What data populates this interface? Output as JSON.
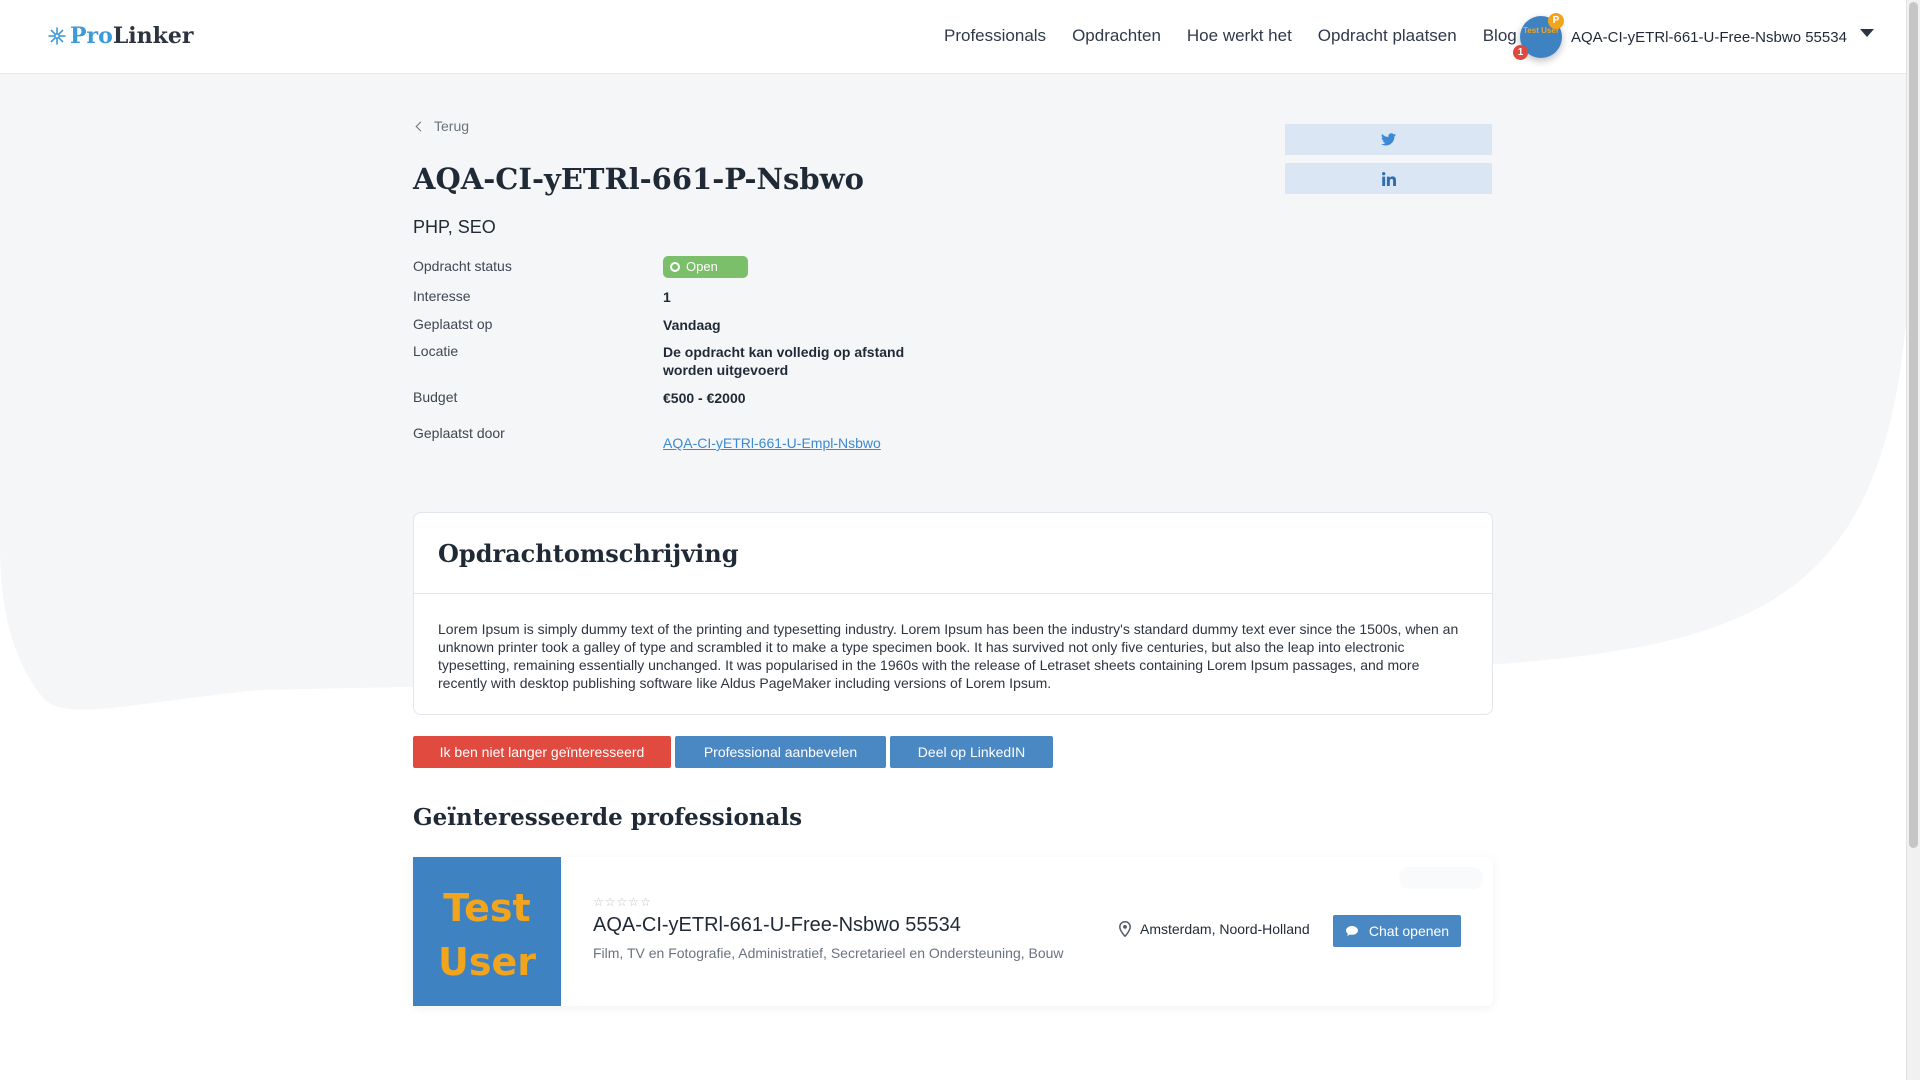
{
  "header": {
    "logo_pro": "Pro",
    "logo_linker": "Linker",
    "nav": [
      "Professionals",
      "Opdrachten",
      "Hoe werkt het",
      "Opdracht plaatsen",
      "Blog"
    ],
    "avatar_text": "Test User",
    "avatar_badge": "P",
    "notification_count": "1",
    "user_name": "AQA-CI-yETRl-661-U-Free-Nsbwo 55534"
  },
  "page": {
    "back_label": "Terug",
    "title": "AQA-CI-yETRl-661-P-Nsbwo",
    "skills": "PHP, SEO",
    "share_icons": [
      "twitter-icon",
      "linkedin-icon"
    ]
  },
  "details": {
    "status_label": "Opdracht status",
    "status_value": "Open",
    "interest_label": "Interesse",
    "interest_value": "1",
    "posted_label": "Geplaatst op",
    "posted_value": "Vandaag",
    "location_label": "Locatie",
    "location_value": "De opdracht kan volledig op afstand worden uitgevoerd",
    "budget_label": "Budget",
    "budget_value": "€500 - €2000",
    "posted_by_label": "Geplaatst door",
    "posted_by_value": "AQA-CI-yETRl-661-U-Empl-Nsbwo"
  },
  "description": {
    "heading": "Opdrachtomschrijving",
    "text": "Lorem Ipsum is simply dummy text of the printing and typesetting industry. Lorem Ipsum has been the industry's standard dummy text ever since the 1500s, when an unknown printer took a galley of type and scrambled it to make a type specimen book. It has survived not only five centuries, but also the leap into electronic typesetting, remaining essentially unchanged. It was popularised in the 1960s with the release of Letraset sheets containing Lorem Ipsum passages, and more recently with desktop publishing software like Aldus PageMaker including versions of Lorem Ipsum."
  },
  "actions": {
    "not_interested": "Ik ben niet langer geïnteresseerd",
    "recommend": "Professional aanbevelen",
    "share_linkedin": "Deel op LinkedIN"
  },
  "interested": {
    "heading": "Geïnteresseerde professionals",
    "items": [
      {
        "image_text_1": "Test",
        "image_text_2": "User",
        "rating": 0,
        "rating_max": 5,
        "name": "AQA-CI-yETRl-661-U-Free-Nsbwo 55534",
        "categories": "Film, TV en Fotografie, Administratief, Secretarieel en Ondersteuning, Bouw",
        "location": "Amsterdam, Noord-Holland",
        "chat_label": "Chat openen"
      }
    ]
  },
  "colors": {
    "accent": "#4a88c4",
    "danger": "#e04a3f",
    "status_open": "#7bbf6a",
    "background_shape": "#f5f6f8",
    "avatar_bg": "#3f82c2",
    "avatar_text": "#f2a51c"
  }
}
